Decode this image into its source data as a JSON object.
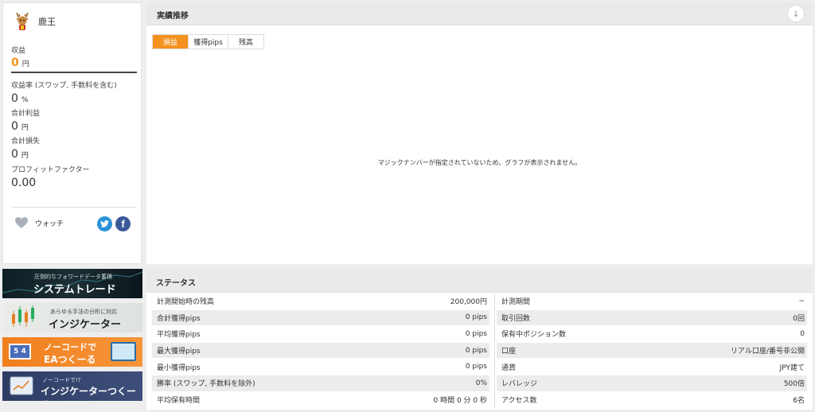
{
  "profile": {
    "name": "鹿王",
    "stats": [
      {
        "label": "収益",
        "value": "0",
        "unit": "円"
      },
      {
        "label": "収益率 (スワップ, 手数料を含む)",
        "value": "0",
        "unit": "%"
      },
      {
        "label": "合計利益",
        "value": "0",
        "unit": "円"
      },
      {
        "label": "合計損失",
        "value": "0",
        "unit": "円"
      },
      {
        "label": "プロフィットファクター",
        "value": "0.00",
        "unit": ""
      }
    ],
    "watch_label": "ウォッチ",
    "facebook_glyph": "f"
  },
  "banners": [
    {
      "small": "圧倒的なフォワードデータ蓄積",
      "big": "システムトレード"
    },
    {
      "small": "あらゆる手法の分析に対応",
      "big": "インジケーター"
    },
    {
      "small": "ノーコードで",
      "big": "EAつくーる"
    },
    {
      "small": "ノーコードで!?",
      "big": "インジケーターつくーる"
    }
  ],
  "performance": {
    "title": "実績推移",
    "tabs": [
      "損益",
      "獲得pips",
      "残高"
    ],
    "active_tab": 0,
    "empty_message": "マジックナンバーが指定されていないため、グラフが表示されません。"
  },
  "status": {
    "title": "ステータス",
    "left": [
      {
        "label": "計測開始時の残高",
        "value": "200,000円"
      },
      {
        "label": "合計獲得pips",
        "value": "0 pips"
      },
      {
        "label": "平均獲得pips",
        "value": "0 pips"
      },
      {
        "label": "最大獲得pips",
        "value": "0 pips"
      },
      {
        "label": "最小獲得pips",
        "value": "0 pips"
      },
      {
        "label": "勝率 (スワップ, 手数料を除外)",
        "value": "0%"
      },
      {
        "label": "平均保有時間",
        "value": "0 時間 0 分 0 秒"
      }
    ],
    "right": [
      {
        "label": "計測期間",
        "value": "~"
      },
      {
        "label": "取引回数",
        "value": "0回"
      },
      {
        "label": "保有中ポジション数",
        "value": "0"
      },
      {
        "label": "口座",
        "value": "リアル口座/番号非公開"
      },
      {
        "label": "通貨",
        "value": "JPY建て"
      },
      {
        "label": "レバレッジ",
        "value": "500倍"
      },
      {
        "label": "アクセス数",
        "value": "6名"
      }
    ]
  },
  "colors": {
    "accent": "#f5911e",
    "twitter": "#2a92d8",
    "facebook": "#3b5998"
  }
}
